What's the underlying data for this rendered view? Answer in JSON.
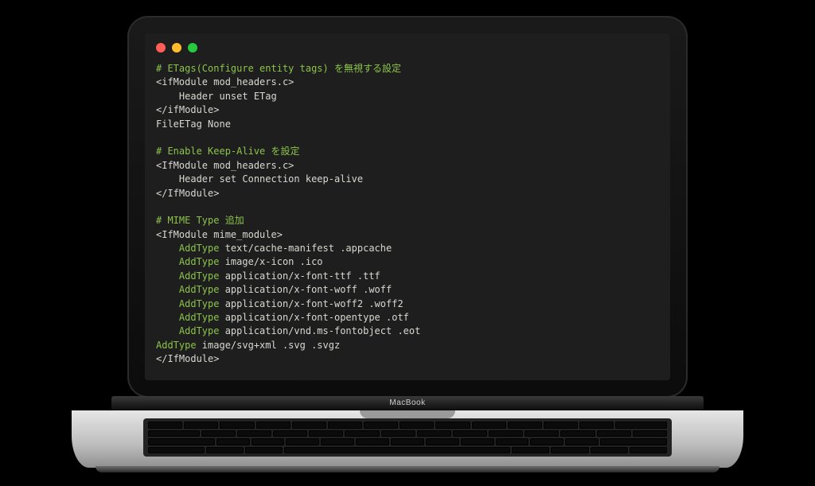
{
  "device": {
    "brand": "MacBook"
  },
  "window": {
    "traffic": [
      "close",
      "minimize",
      "zoom"
    ]
  },
  "code": {
    "block1": {
      "comment": "# ETags(Configure entity tags) を無視する設定",
      "l1": "<ifModule mod_headers.c>",
      "l2": "    Header unset ETag",
      "l3": "</ifModule>",
      "l4": "FileETag None"
    },
    "block2": {
      "comment": "# Enable Keep-Alive を設定",
      "l1": "<IfModule mod_headers.c>",
      "l2": "    Header set Connection keep-alive",
      "l3": "</IfModule>"
    },
    "block3": {
      "comment": "# MIME Type 追加",
      "l1": "<IfModule mime_module>",
      "a1k": "    AddType",
      "a1v": " text/cache-manifest .appcache",
      "a2k": "    AddType",
      "a2v": " image/x-icon .ico",
      "a3k": "    AddType",
      "a3v": " application/x-font-ttf .ttf",
      "a4k": "    AddType",
      "a4v": " application/x-font-woff .woff",
      "a5k": "    AddType",
      "a5v": " application/x-font-woff2 .woff2",
      "a6k": "    AddType",
      "a6v": " application/x-font-opentype .otf",
      "a7k": "    AddType",
      "a7v": " application/vnd.ms-fontobject .eot",
      "a8k": "AddType",
      "a8v": " image/svg+xml .svg .svgz",
      "l2": "</IfModule>"
    }
  }
}
